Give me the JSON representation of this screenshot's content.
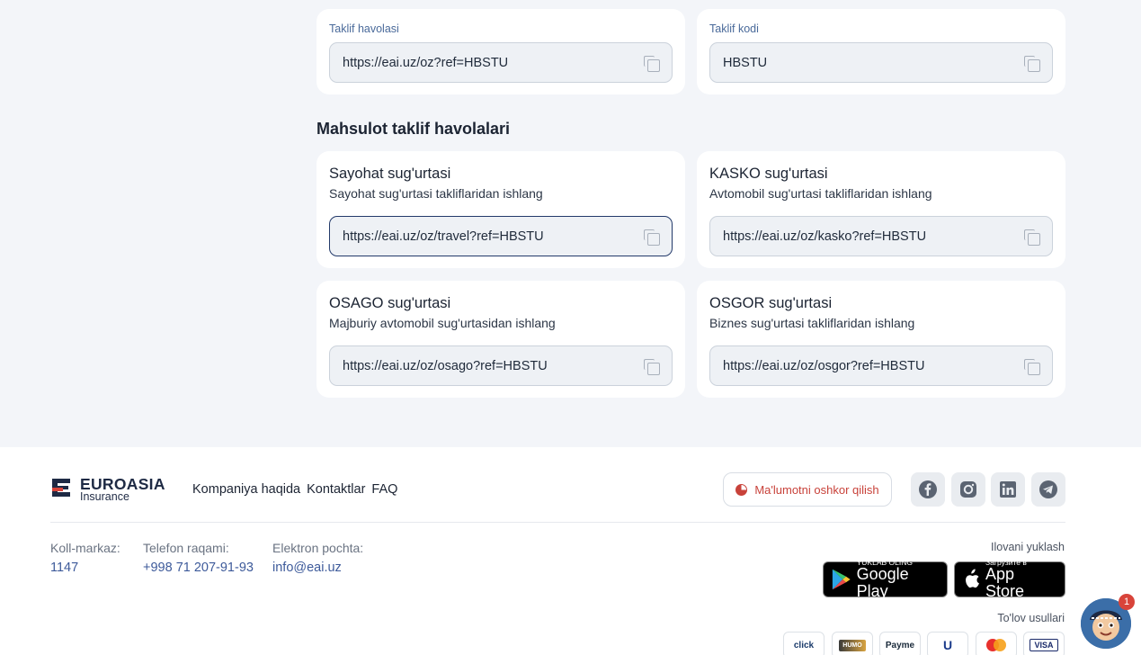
{
  "referral": {
    "link_label": "Taklif havolasi",
    "link_value": "https://eai.uz/oz?ref=HBSTU",
    "code_label": "Taklif kodi",
    "code_value": "HBSTU"
  },
  "products": {
    "title": "Mahsulot taklif havolalari",
    "items": [
      {
        "title": "Sayohat sug'urtasi",
        "subtitle": "Sayohat sug'urtasi takliflaridan ishlang",
        "link": "https://eai.uz/oz/travel?ref=HBSTU"
      },
      {
        "title": "KASKO sug'urtasi",
        "subtitle": "Avtomobil sug'urtasi takliflaridan ishlang",
        "link": "https://eai.uz/oz/kasko?ref=HBSTU"
      },
      {
        "title": "OSAGO sug'urtasi",
        "subtitle": "Majburiy avtomobil sug'urtasidan ishlang",
        "link": "https://eai.uz/oz/osago?ref=HBSTU"
      },
      {
        "title": "OSGOR sug'urtasi",
        "subtitle": "Biznes sug'urtasi takliflaridan ishlang",
        "link": "https://eai.uz/oz/osgor?ref=HBSTU"
      }
    ]
  },
  "footer": {
    "logo": {
      "name": "EUROASIA",
      "sub": "Insurance"
    },
    "nav": [
      "Kompaniya haqida",
      "Kontaktlar",
      "FAQ"
    ],
    "disclose": "Ma'lumotni oshkor qilish",
    "social_icons": [
      "facebook-icon",
      "instagram-icon",
      "linkedin-icon",
      "telegram-icon"
    ],
    "contacts": [
      {
        "label": "Koll-markaz:",
        "value": "1147"
      },
      {
        "label": "Telefon raqami:",
        "value": "+998 71 207-91-93"
      },
      {
        "label": "Elektron pochta:",
        "value": "info@eai.uz"
      }
    ],
    "apps_label": "Ilovani yuklash",
    "google_play": {
      "small": "YUKLAB OLING",
      "big": "Google Play"
    },
    "app_store": {
      "small": "Загрузите в",
      "big": "App Store"
    },
    "payment_label": "To'lov usullari",
    "payments": [
      "click",
      "HUMO",
      "Payme",
      "U",
      "Mastercard",
      "VISA"
    ]
  },
  "chat_badge": "1",
  "colors": {
    "accent": "#3d5a9a",
    "danger": "#c8423a",
    "bg": "#f3f5f9"
  }
}
